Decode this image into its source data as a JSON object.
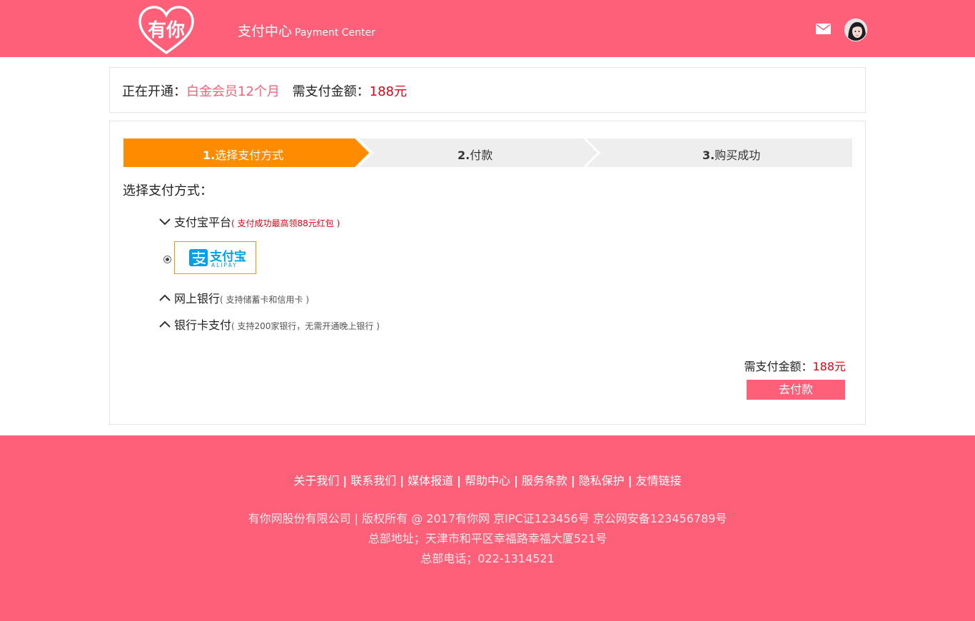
{
  "header": {
    "logo_text": "有你",
    "title_cn": "支付中心",
    "title_en": "Payment Center",
    "icons": [
      "heart-logo-icon",
      "mail-icon",
      "avatar"
    ]
  },
  "summary": {
    "opening_label": "正在开通：",
    "product": "白金会员12个月",
    "amount_label": "需支付金额：",
    "amount": "188元"
  },
  "steps": [
    {
      "num": "1.",
      "label": "选择支付方式",
      "active": true
    },
    {
      "num": "2.",
      "label": "付款",
      "active": false
    },
    {
      "num": "3.",
      "label": "购买成功",
      "active": false
    }
  ],
  "section_title": "选择支付方式：",
  "payment_methods": [
    {
      "name": "支付宝平台",
      "note": "( 支付成功最高领88元红包 )",
      "expanded": true
    },
    {
      "name": "网上银行",
      "note": "( 支持储蓄卡和信用卡 )",
      "expanded": false
    },
    {
      "name": "银行卡支付",
      "note": "( 支持200家银行，无需开通晚上银行 )",
      "expanded": false
    }
  ],
  "alipay": {
    "cn": "支付宝",
    "en": "ALIPAY",
    "selected": true
  },
  "footer_total": {
    "label": "需支付金额：",
    "amount": "188元"
  },
  "pay_button": "去付款",
  "footer": {
    "links": [
      "关于我们",
      "联系我们",
      "媒体报道",
      "帮助中心",
      "服务条款",
      "隐私保护",
      "友情链接"
    ],
    "copyright": "有你网股份有限公司 | 版权所有 @ 2017有你网 京IPC证123456号 京公网安备123456789号",
    "address": "总部地址；天津市和平区幸福路幸福大厦521号",
    "phone": "总部电话；022-1314521"
  },
  "colors": {
    "brand_pink": "#ff6079",
    "step_active": "#ff8c00",
    "step_inactive": "#eeeeee",
    "price_red": "#e60012",
    "alipay_blue": "#00a0e9"
  }
}
